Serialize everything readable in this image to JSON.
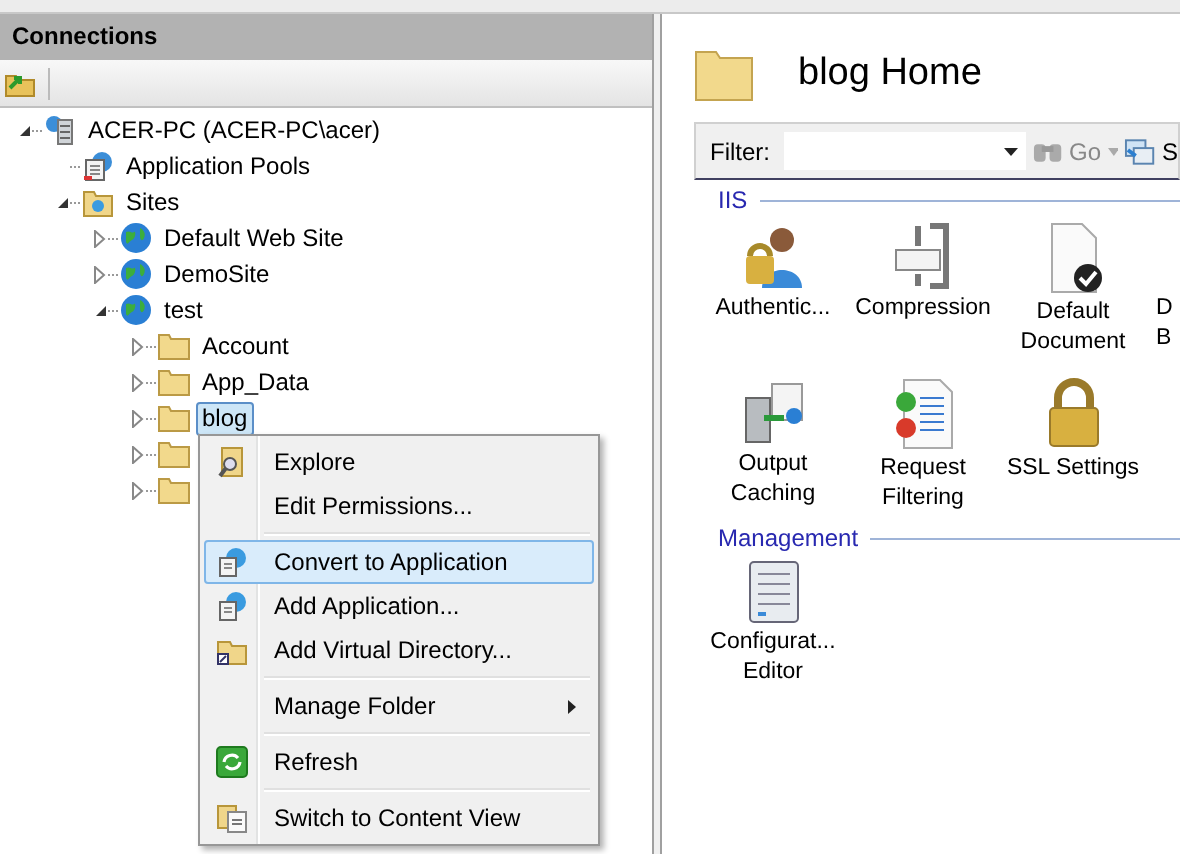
{
  "connections": {
    "title": "Connections",
    "tree": [
      {
        "kind": "server",
        "label": "ACER-PC (ACER-PC\\acer)",
        "expanded": true,
        "selected": false,
        "children": [
          {
            "kind": "pools",
            "label": "Application Pools",
            "selected": false
          },
          {
            "kind": "sites",
            "label": "Sites",
            "expanded": true,
            "selected": false,
            "children": [
              {
                "kind": "site",
                "label": "Default Web Site",
                "expanded": false,
                "selected": false
              },
              {
                "kind": "site",
                "label": "DemoSite",
                "expanded": false,
                "selected": false
              },
              {
                "kind": "site",
                "label": "test",
                "expanded": true,
                "selected": false,
                "children": [
                  {
                    "kind": "folder",
                    "label": "Account",
                    "expanded": false,
                    "selected": false
                  },
                  {
                    "kind": "folder",
                    "label": "App_Data",
                    "expanded": false,
                    "selected": false
                  },
                  {
                    "kind": "folder",
                    "label": "blog",
                    "expanded": false,
                    "selected": true
                  },
                  {
                    "kind": "folder",
                    "expanded": false,
                    "selected": false
                  },
                  {
                    "kind": "folder",
                    "expanded": false,
                    "selected": false
                  }
                ]
              }
            ]
          }
        ]
      }
    ]
  },
  "context_menu": [
    {
      "kind": "explore",
      "label": "Explore",
      "selected": false
    },
    {
      "kind": "plain",
      "label": "Edit Permissions...",
      "selected": false
    },
    {
      "kind": "separator"
    },
    {
      "kind": "application",
      "label": "Convert to Application",
      "selected": true
    },
    {
      "kind": "application",
      "label": "Add Application...",
      "selected": false
    },
    {
      "kind": "directory",
      "label": "Add Virtual Directory...",
      "selected": false
    },
    {
      "kind": "separator"
    },
    {
      "kind": "plain",
      "label": "Manage Folder",
      "submenu": true,
      "selected": false
    },
    {
      "kind": "separator"
    },
    {
      "kind": "refresh",
      "label": "Refresh",
      "selected": false
    },
    {
      "kind": "separator"
    },
    {
      "kind": "content",
      "label": "Switch to Content View",
      "selected": false
    }
  ],
  "home": {
    "title": "blog Home",
    "filter_bar": {
      "label": "Filter:",
      "go": "Go",
      "cut_button": "S"
    },
    "groups": [
      {
        "title": "IIS",
        "features": [
          {
            "kind": "auth",
            "label": "Authentic..."
          },
          {
            "kind": "compression",
            "label": "Compression"
          },
          {
            "kind": "document",
            "label": "Default Document"
          },
          {
            "kind": "cut",
            "label": "D B"
          },
          {
            "kind": "caching",
            "label": "Output Caching"
          },
          {
            "kind": "filtering",
            "label": "Request Filtering"
          },
          {
            "kind": "ssl",
            "label": "SSL Settings"
          }
        ]
      },
      {
        "title": "Management",
        "features": [
          {
            "kind": "config",
            "label": "Configurat... Editor"
          }
        ]
      }
    ]
  }
}
